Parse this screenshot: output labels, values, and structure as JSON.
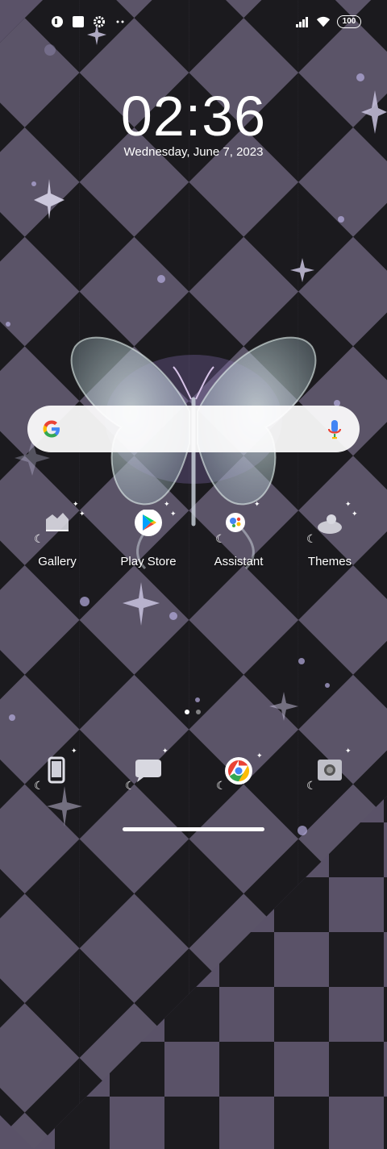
{
  "status_bar": {
    "left_icons": [
      "photo-badge-icon",
      "square-notification-icon",
      "gear-icon",
      "more-dots-icon"
    ],
    "battery": "100"
  },
  "lockclock": {
    "time": "02:36",
    "date": "Wednesday, June 7, 2023"
  },
  "search": {
    "logo": "google-g-icon",
    "mic": "mic-icon"
  },
  "apps": [
    {
      "label": "Gallery",
      "icon": "gallery-icon"
    },
    {
      "label": "Play Store",
      "icon": "play-store-icon"
    },
    {
      "label": "Assistant",
      "icon": "assistant-icon"
    },
    {
      "label": "Themes",
      "icon": "themes-icon"
    }
  ],
  "dock": [
    {
      "icon": "phone-icon"
    },
    {
      "icon": "messages-icon"
    },
    {
      "icon": "chrome-icon"
    },
    {
      "icon": "camera-icon"
    }
  ],
  "page_indicator": {
    "pages": 2,
    "current": 1
  },
  "colors": {
    "wallpaper_dark": "#1b1a1e",
    "wallpaper_light": "#5b5468",
    "search_bg": "#ffffff"
  }
}
